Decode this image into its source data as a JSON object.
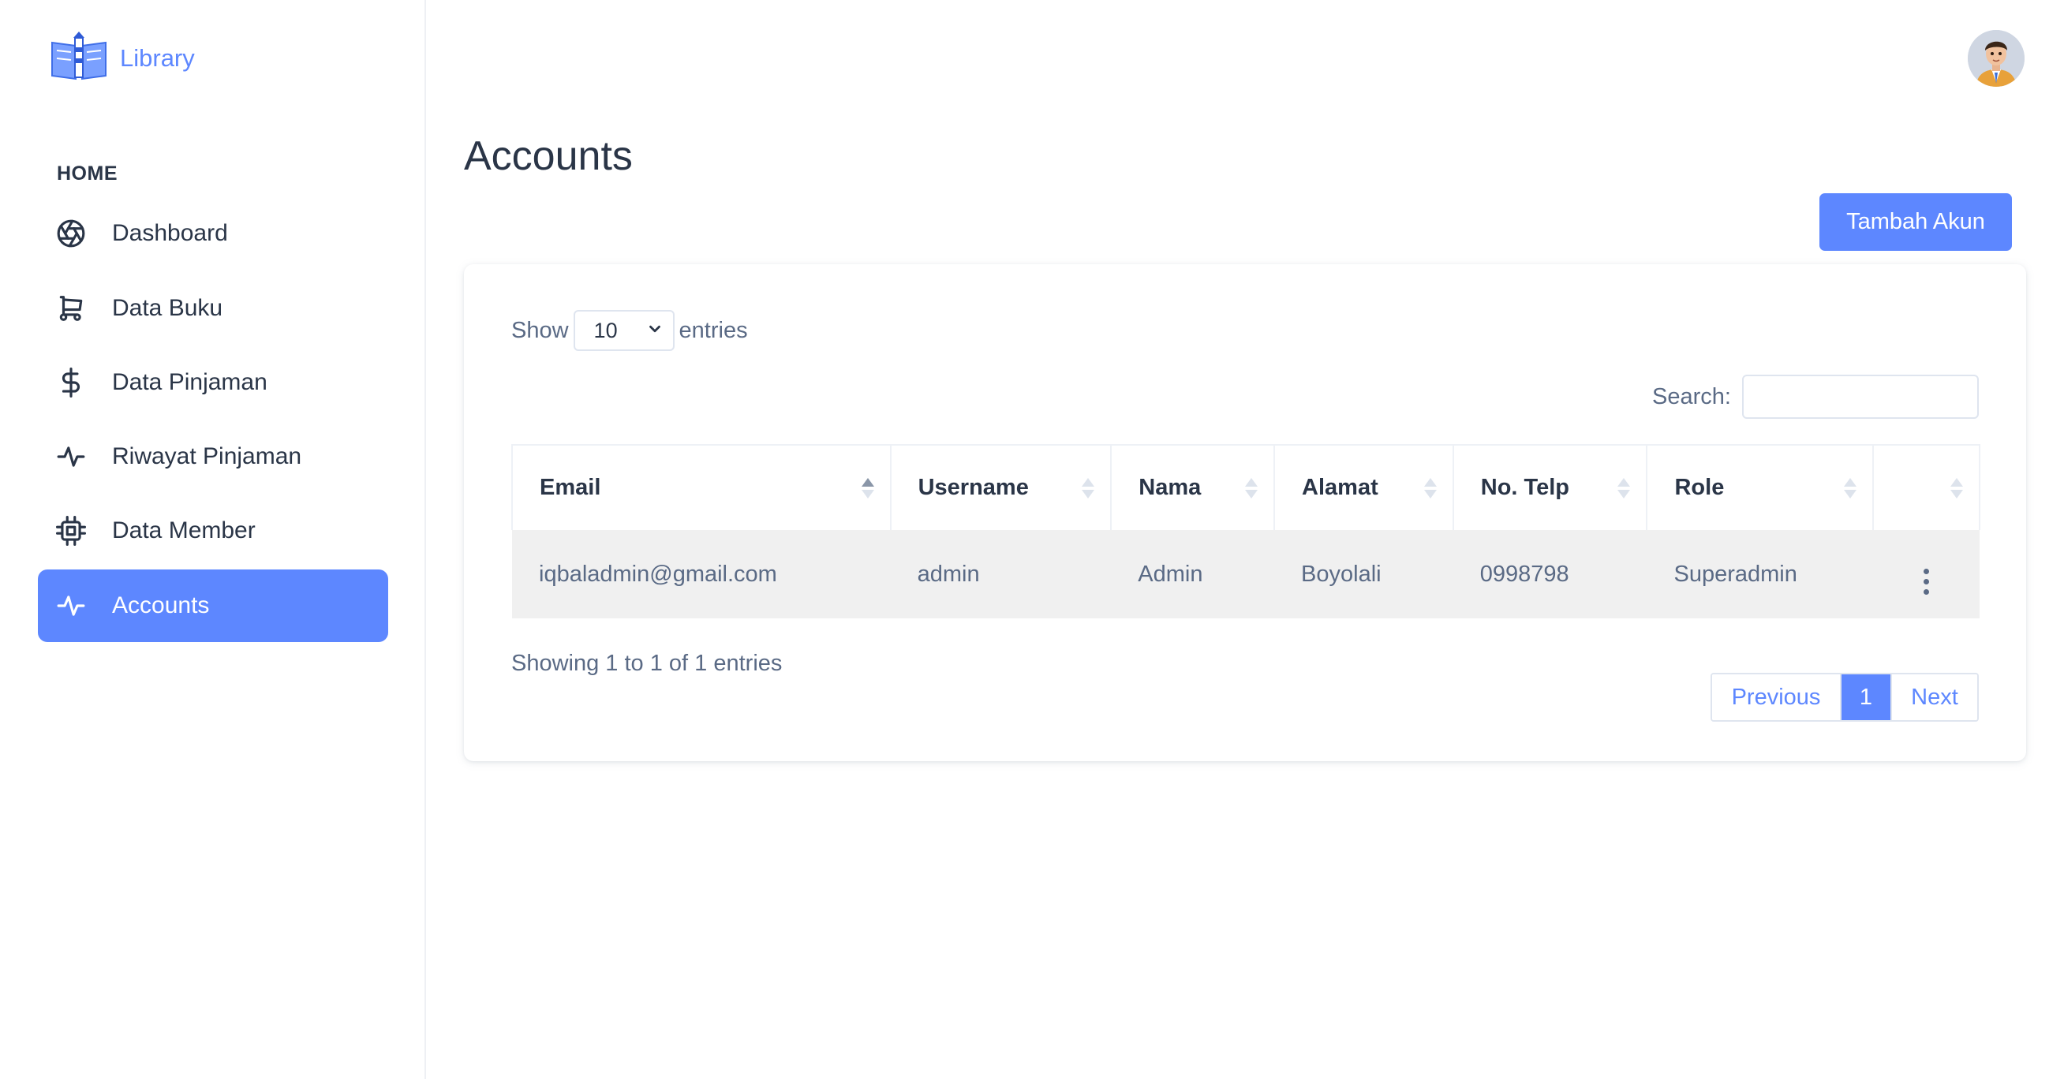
{
  "brand": {
    "name": "Library"
  },
  "sidebar": {
    "section_label": "HOME",
    "items": [
      {
        "label": "Dashboard",
        "icon": "aperture-icon"
      },
      {
        "label": "Data Buku",
        "icon": "shopping-cart-icon"
      },
      {
        "label": "Data Pinjaman",
        "icon": "dollar-sign-icon"
      },
      {
        "label": "Riwayat Pinjaman",
        "icon": "activity-icon"
      },
      {
        "label": "Data Member",
        "icon": "cpu-chip-icon"
      },
      {
        "label": "Accounts",
        "icon": "activity-icon",
        "active": true
      }
    ]
  },
  "header": {
    "avatar_icon": "user-avatar-icon"
  },
  "main": {
    "title": "Accounts",
    "add_button": "Tambah Akun",
    "table_controls": {
      "show_prefix": "Show",
      "show_value": "10",
      "show_suffix": "entries",
      "search_label": "Search:",
      "search_value": ""
    },
    "table": {
      "columns": [
        "Email",
        "Username",
        "Nama",
        "Alamat",
        "No. Telp",
        "Role",
        ""
      ],
      "sorted_column": "Email",
      "rows": [
        {
          "email": "iqbaladmin@gmail.com",
          "username": "admin",
          "nama": "Admin",
          "alamat": "Boyolali",
          "telp": "0998798",
          "role": "Superadmin"
        }
      ]
    },
    "info": "Showing 1 to 1 of 1 entries",
    "pagination": {
      "previous": "Previous",
      "current": "1",
      "next": "Next"
    }
  },
  "colors": {
    "accent": "#5d87ff",
    "text_dark": "#2a3547",
    "text_muted": "#5a6a85",
    "row_bg": "#f0f0f0"
  }
}
